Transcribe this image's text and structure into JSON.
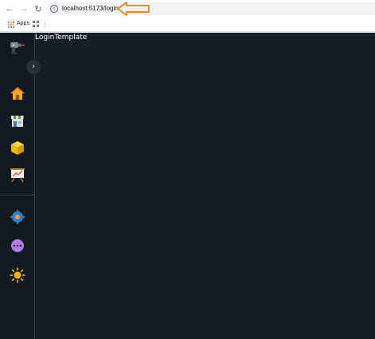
{
  "browser": {
    "url": "localhost:5173/login",
    "bookmarks": {
      "apps_label": "Apps"
    }
  },
  "annotation": {
    "arrow_color": "#f08a24"
  },
  "app": {
    "title": "LoginTemplate",
    "background": "#151e26",
    "sidebar": {
      "logo_icon": "drill-icon",
      "toggle_icon": "chevron-right-icon",
      "items": [
        {
          "icon": "home-icon"
        },
        {
          "icon": "store-icon"
        },
        {
          "icon": "box-icon"
        },
        {
          "icon": "presentation-chart-icon"
        }
      ],
      "secondary_items": [
        {
          "icon": "settings-gear-icon"
        },
        {
          "icon": "more-dots-icon"
        },
        {
          "icon": "sun-icon"
        }
      ]
    }
  }
}
